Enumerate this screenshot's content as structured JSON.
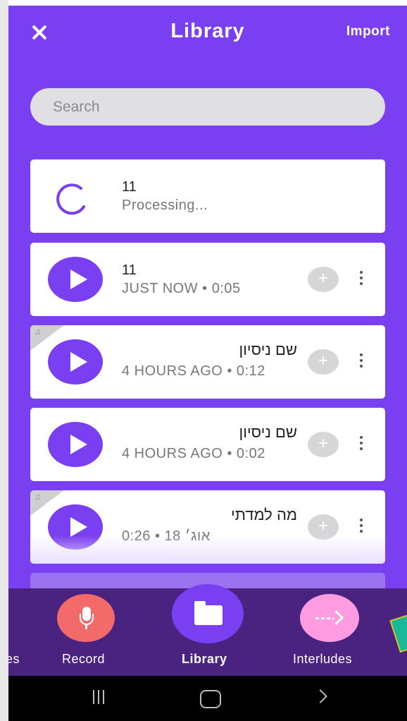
{
  "header": {
    "title": "Library",
    "import_label": "Import"
  },
  "search": {
    "placeholder": "Search"
  },
  "recordings": [
    {
      "name": "11",
      "meta": "Processing...",
      "state": "processing",
      "has_music_tag": false
    },
    {
      "name": "11",
      "meta": "JUST NOW • 0:05",
      "state": "ready",
      "has_music_tag": false
    },
    {
      "name": "שם ניסיון",
      "meta": "4 HOURS AGO • 0:12",
      "state": "ready",
      "has_music_tag": true
    },
    {
      "name": "שם ניסיון",
      "meta": "4 HOURS AGO • 0:02",
      "state": "ready",
      "has_music_tag": false
    },
    {
      "name": "מה למדתי",
      "meta": "0:26 • 18 אוג׳",
      "state": "ready",
      "has_music_tag": true
    }
  ],
  "actions": {
    "add_label": "+"
  },
  "music_tag_symbol": "♫",
  "nav": {
    "partial_label": "es",
    "record_label": "Record",
    "library_label": "Library",
    "interludes_label": "Interludes",
    "active_tab": "Library"
  },
  "colors": {
    "primary": "#7a3ff0",
    "nav_bg": "#4a2380",
    "record": "#f26a6a",
    "interludes": "#ff9be0"
  }
}
